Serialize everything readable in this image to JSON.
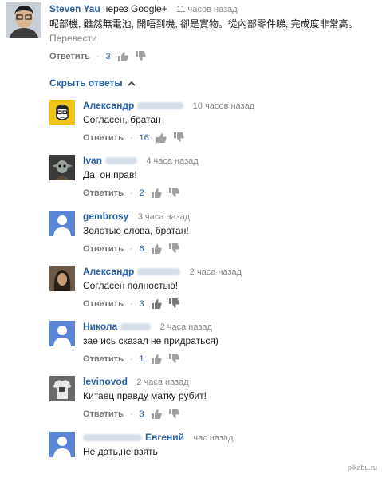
{
  "main": {
    "author": "Steven Yau",
    "via": "через Google+",
    "time": "11 часов назад",
    "text": "呢部機, 雖然無電池, 開唔到機, 卻是實物。從內部零件睇, 完成度非常高。",
    "translate": "Перевести",
    "reply_label": "Ответить",
    "likes": "3"
  },
  "hide_replies": "Скрыть ответы",
  "replies": [
    {
      "author": "Александр",
      "time": "10 часов назад",
      "text": "Согласен, братан",
      "reply_label": "Ответить",
      "likes": "16"
    },
    {
      "author": "Ivan",
      "time": "4 часа назад",
      "text": "Да, он прав!",
      "reply_label": "Ответить",
      "likes": "2"
    },
    {
      "author": "gembrosy",
      "time": "3 часа назад",
      "text": "Золотые слова, братан!",
      "reply_label": "Ответить",
      "likes": "6"
    },
    {
      "author": "Александр",
      "time": "2 часа назад",
      "text": "Согласен полностью!",
      "reply_label": "Ответить",
      "likes": "3"
    },
    {
      "author": "Никола",
      "time": "2 часа назад",
      "text": "зае  ись сказал не придраться)",
      "reply_label": "Ответить",
      "likes": "1"
    },
    {
      "author": "levinovod",
      "time": "2 часа назад",
      "text": "Китаец правду матку рубит!",
      "reply_label": "Ответить",
      "likes": "3"
    },
    {
      "author": "Евгений",
      "time": "час назад",
      "text": "Не дать,не взять",
      "reply_label": "",
      "likes": ""
    }
  ],
  "watermark": "pikabu.ru",
  "colors": {
    "link": "#2a62a8",
    "meta": "#888888",
    "avatar_default": "#5b86d6"
  }
}
